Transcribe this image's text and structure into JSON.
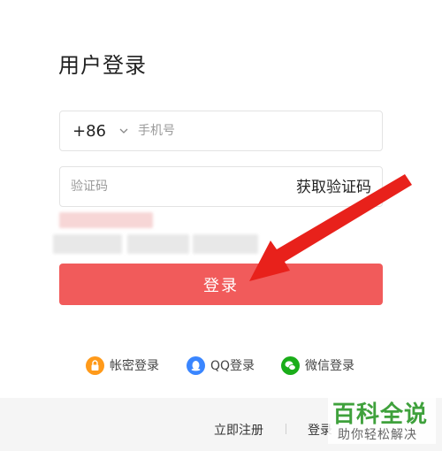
{
  "page": {
    "title": "用户登录"
  },
  "phone": {
    "country_code": "+86",
    "placeholder": "手机号"
  },
  "code": {
    "placeholder": "验证码",
    "get_code_label": "获取验证码"
  },
  "login_button": {
    "label": "登录"
  },
  "alt_logins": [
    {
      "label": "帐密登录",
      "icon": "lock-icon",
      "color": "#ff9a1a"
    },
    {
      "label": "QQ登录",
      "icon": "qq-penguin-icon",
      "color": "#3a86ff"
    },
    {
      "label": "微信登录",
      "icon": "wechat-icon",
      "color": "#1aad19"
    }
  ],
  "footer": {
    "register_label": "立即注册",
    "login_label": "登录"
  },
  "watermark": {
    "title": "百科全说",
    "subtitle": "助你轻松解决"
  },
  "colors": {
    "primary": "#f15b5b",
    "arrow": "#e8211b",
    "watermark": "#3fa13c"
  }
}
